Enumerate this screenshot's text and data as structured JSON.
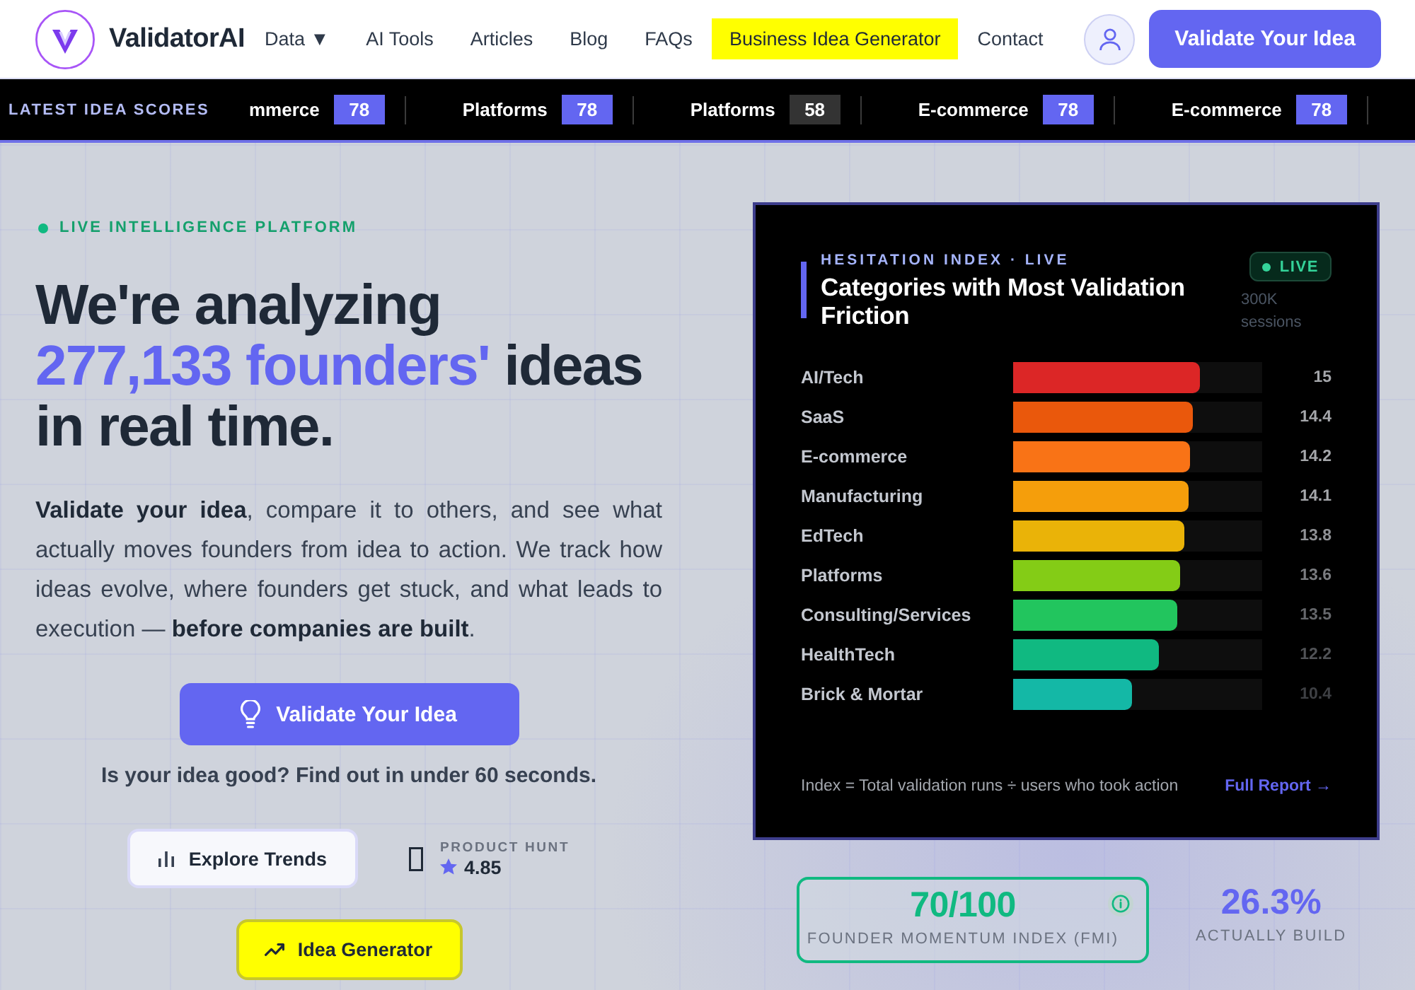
{
  "header": {
    "brand": "ValidatorAI",
    "nav": [
      {
        "label": "Data ▼",
        "highlighted": false
      },
      {
        "label": "AI Tools",
        "highlighted": false
      },
      {
        "label": "Articles",
        "highlighted": false
      },
      {
        "label": "Blog",
        "highlighted": false
      },
      {
        "label": "FAQs",
        "highlighted": false
      },
      {
        "label": "Business Idea Generator",
        "highlighted": true
      },
      {
        "label": "Contact",
        "highlighted": false
      }
    ],
    "cta": "Validate Your Idea"
  },
  "ticker": {
    "label": "LATEST IDEA SCORES",
    "items": [
      {
        "category": "mmerce",
        "score": "78",
        "color": "#6366f1"
      },
      {
        "category": "Platforms",
        "score": "78",
        "color": "#6366f1"
      },
      {
        "category": "Platforms",
        "score": "58",
        "color": "#333333"
      },
      {
        "category": "E-commerce",
        "score": "78",
        "color": "#6366f1"
      },
      {
        "category": "E-commerce",
        "score": "78",
        "color": "#6366f1"
      }
    ]
  },
  "hero": {
    "eyebrow": "LIVE INTELLIGENCE PLATFORM",
    "headline": {
      "lead": "We're analyzing",
      "highlight": "277,133 founders'",
      "tail": "ideas in real time."
    },
    "intro": "**Validate your idea**, compare it to others, and see what actually moves founders from idea to action. We track how ideas evolve, where founders get stuck, and what leads to execution — **before companies are built**.",
    "primary_button": "Validate Your Idea",
    "tagline": "Is your idea good? Find out in under 60 seconds.",
    "secondary_button": "Explore Trends",
    "product_hunt": {
      "label": "PRODUCT HUNT",
      "rating": "4.85"
    },
    "generator_button": "Idea Generator"
  },
  "card": {
    "eyebrow": "HESITATION INDEX · LIVE",
    "title": "Categories with Most Validation Friction",
    "live_badge": "LIVE",
    "sessions": "300K sessions",
    "rows": [
      {
        "label": "AI/Tech",
        "level": 0.748,
        "reading": "15",
        "color": "#dc2626"
      },
      {
        "label": "SaaS",
        "level": 0.722,
        "reading": "14.4",
        "color": "#ea580c"
      },
      {
        "label": "E-commerce",
        "level": 0.709,
        "reading": "14.2",
        "color": "#f97316"
      },
      {
        "label": "Manufacturing",
        "level": 0.705,
        "reading": "14.1",
        "color": "#f59e0b"
      },
      {
        "label": "EdTech",
        "level": 0.686,
        "reading": "13.8",
        "color": "#eab308"
      },
      {
        "label": "Platforms",
        "level": 0.67,
        "reading": "13.6",
        "color": "#84cc16"
      },
      {
        "label": "Consulting/Services",
        "level": 0.659,
        "reading": "13.5",
        "color": "#22c55e"
      },
      {
        "label": "HealthTech",
        "level": 0.584,
        "reading": "12.2",
        "color": "#10b981"
      },
      {
        "label": "Brick & Mortar",
        "level": 0.477,
        "reading": "10.4",
        "color": "#14b8a6"
      }
    ],
    "footnote": "Index = Total validation runs ÷ users who took action",
    "link": "Full Report →"
  },
  "stats": {
    "fmi": {
      "value": "70/100",
      "label": "FOUNDER MOMENTUM INDEX (FMI)"
    },
    "build": {
      "value": "26.3%",
      "label": "ACTUALLY BUILD"
    }
  }
}
